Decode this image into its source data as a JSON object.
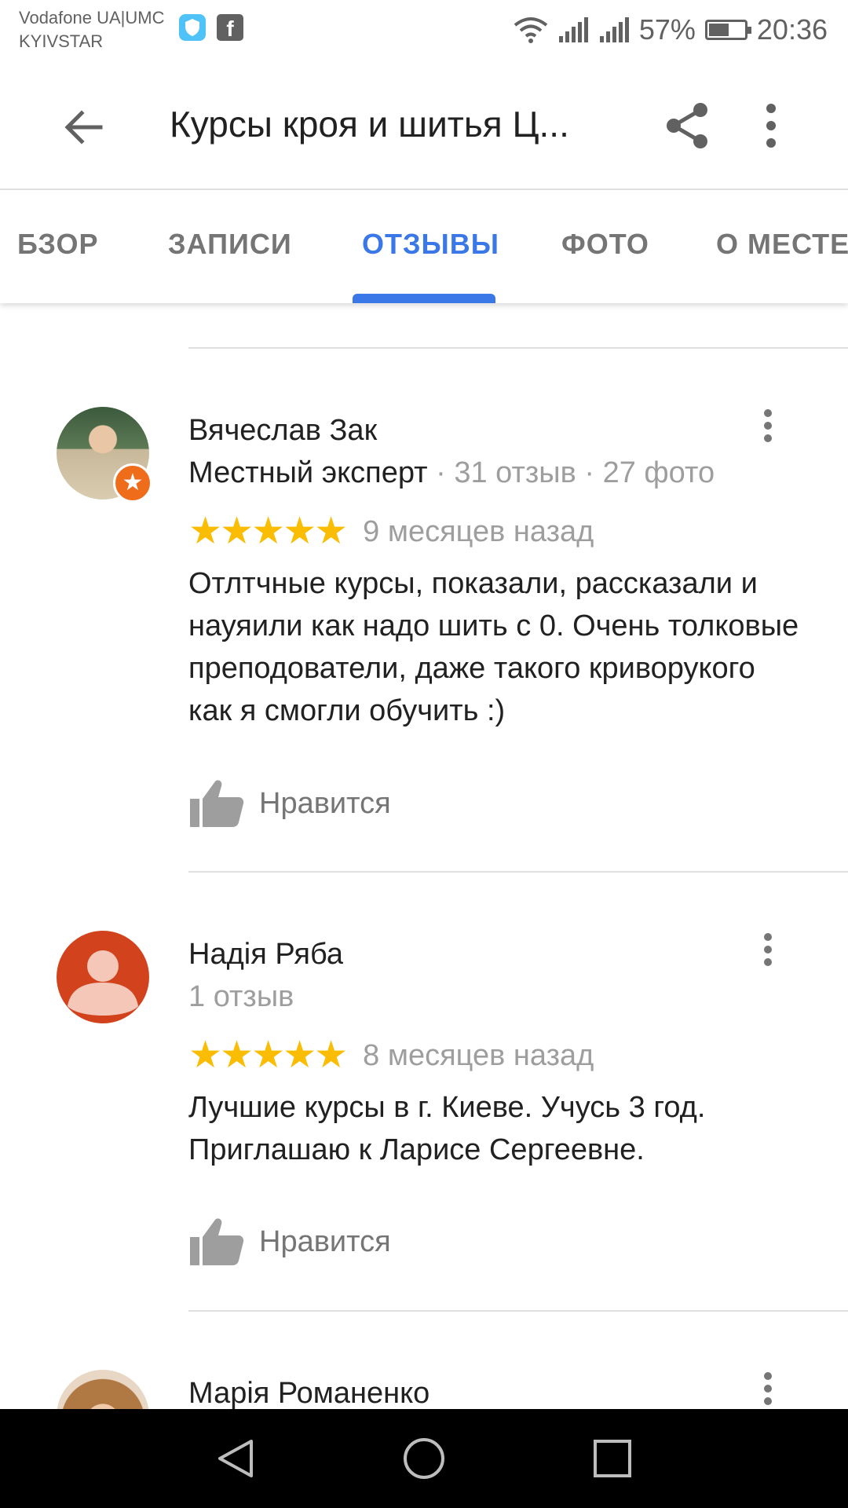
{
  "status_bar": {
    "carrier_line1": "Vodafone UA|UMC",
    "carrier_line2": "KYIVSTAR",
    "battery_percent": "57%",
    "battery_level": 0.57,
    "time": "20:36",
    "icons": [
      "shield-app-icon",
      "facebook-icon",
      "wifi-icon",
      "signal-icon",
      "signal-icon",
      "battery-icon"
    ]
  },
  "app_bar": {
    "title": "Курсы кроя и шитья Ц...",
    "icons": [
      "back-arrow-icon",
      "share-icon",
      "more-vert-icon"
    ]
  },
  "tabs": [
    {
      "label": "БЗОР",
      "active": false
    },
    {
      "label": "ЗАПИСИ",
      "active": false
    },
    {
      "label": "ОТЗЫВЫ",
      "active": true
    },
    {
      "label": "ФОТО",
      "active": false
    },
    {
      "label": "О МЕСТЕ",
      "active": false
    }
  ],
  "colors": {
    "accent": "#3b78e7",
    "star": "#fbbc04",
    "expert_badge": "#ef6c1b",
    "default_avatar": "#d2421c"
  },
  "reviews": [
    {
      "author": "Вячеслав Зак",
      "badge": "Местный эксперт",
      "reviews_count": "31 отзыв",
      "photos_count": "27 фото",
      "rating": 5,
      "stars": "★★★★★",
      "date": "9 месяцев назад",
      "text": "Отлтчные курсы, показали, рассказали и науяили как надо шить с 0. Очень толковые преподователи, даже такого криворукого  как я смогли обучить :)",
      "like_label": "Нравится"
    },
    {
      "author": "Надія Ряба",
      "reviews_count": "1 отзыв",
      "rating": 5,
      "stars": "★★★★★",
      "date": "8 месяцев назад",
      "text": "Лучшие курсы в г. Киеве. Учусь 3 год. Приглашаю к Ларисе Сергеевне.",
      "like_label": "Нравится"
    },
    {
      "author": "Марія Романенко"
    }
  ],
  "meta_separator": "·",
  "nav_bar": {
    "icons": [
      "back-triangle-icon",
      "home-circle-icon",
      "recents-square-icon"
    ]
  }
}
